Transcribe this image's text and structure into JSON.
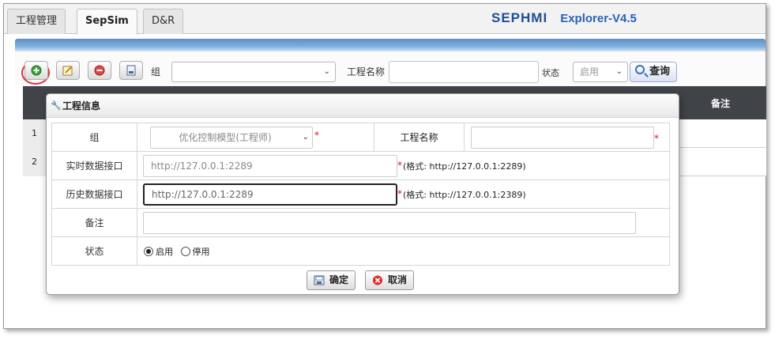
{
  "tabs": [
    {
      "label": "工程管理"
    },
    {
      "label": "SepSim"
    },
    {
      "label": "D&R"
    }
  ],
  "brand": {
    "name": "SEPHMI",
    "version": "Explorer-V4.5"
  },
  "toolbar": {
    "group_label": "组",
    "group_value": "",
    "project_name_label": "工程名称",
    "project_name_value": "",
    "status_label": "状态",
    "status_value": "启用",
    "query_label": "查询",
    "icons": [
      "add-icon",
      "edit-icon",
      "delete-icon",
      "export-icon"
    ]
  },
  "grid": {
    "columns": [
      "备注"
    ],
    "rows": [
      {
        "num": "1"
      },
      {
        "num": "2"
      }
    ]
  },
  "dialog": {
    "title": "工程信息",
    "fields": {
      "group_label": "组",
      "group_value": "优化控制模型(工程师)",
      "project_name_label": "工程名称",
      "project_name_value": "",
      "realtime_label": "实时数据接口",
      "realtime_value": "http://127.0.0.1:2289",
      "realtime_hint": "(格式: http://127.0.0.1:2289)",
      "history_label": "历史数据接口",
      "history_value": "http://127.0.0.1:2289",
      "history_hint": "(格式: http://127.0.0.1:2389)",
      "note_label": "备注",
      "note_value": "",
      "status_label": "状态",
      "status_enabled": "启用",
      "status_disabled": "停用",
      "required_mark": "*"
    },
    "ok_label": "确定",
    "cancel_label": "取消"
  },
  "colors": {
    "brand": "#1f4e96",
    "header": "#404448",
    "required": "#d01818",
    "highlight_ring": "#e0303a"
  }
}
